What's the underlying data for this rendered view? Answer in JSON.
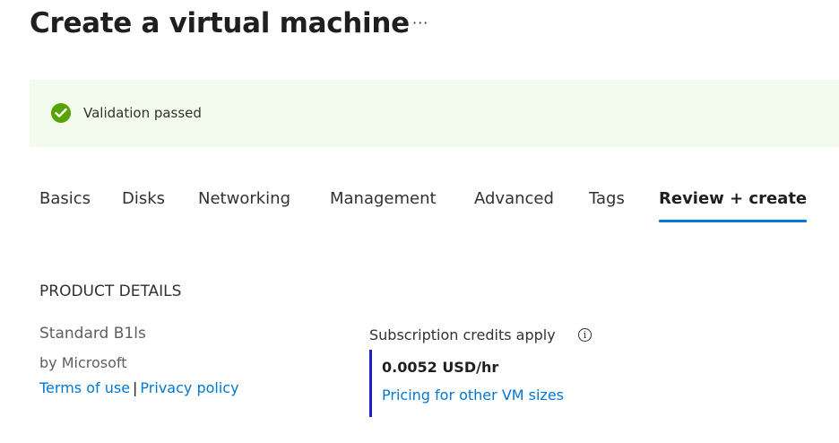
{
  "header": {
    "title": "Create a virtual machine",
    "more_label": "···"
  },
  "banner": {
    "text": "Validation passed",
    "icon": "checkmark-circle-icon",
    "color": "#57a300"
  },
  "tabs": [
    {
      "label": "Basics"
    },
    {
      "label": "Disks"
    },
    {
      "label": "Networking"
    },
    {
      "label": "Management"
    },
    {
      "label": "Advanced"
    },
    {
      "label": "Tags"
    },
    {
      "label": "Review + create",
      "active": true
    }
  ],
  "product": {
    "section_title": "PRODUCT DETAILS",
    "name": "Standard B1ls",
    "publisher": "by Microsoft",
    "terms_link": "Terms of use",
    "separator": "|",
    "privacy_link": "Privacy policy",
    "credits_label": "Subscription credits apply",
    "info_icon": "info-icon",
    "price": "0.0052 USD/hr",
    "pricing_link": "Pricing for other VM sizes"
  },
  "colors": {
    "accent": "#0078d4",
    "banner_bg": "#f3fbed",
    "success": "#57a300",
    "price_bar": "#1f1fc9"
  }
}
